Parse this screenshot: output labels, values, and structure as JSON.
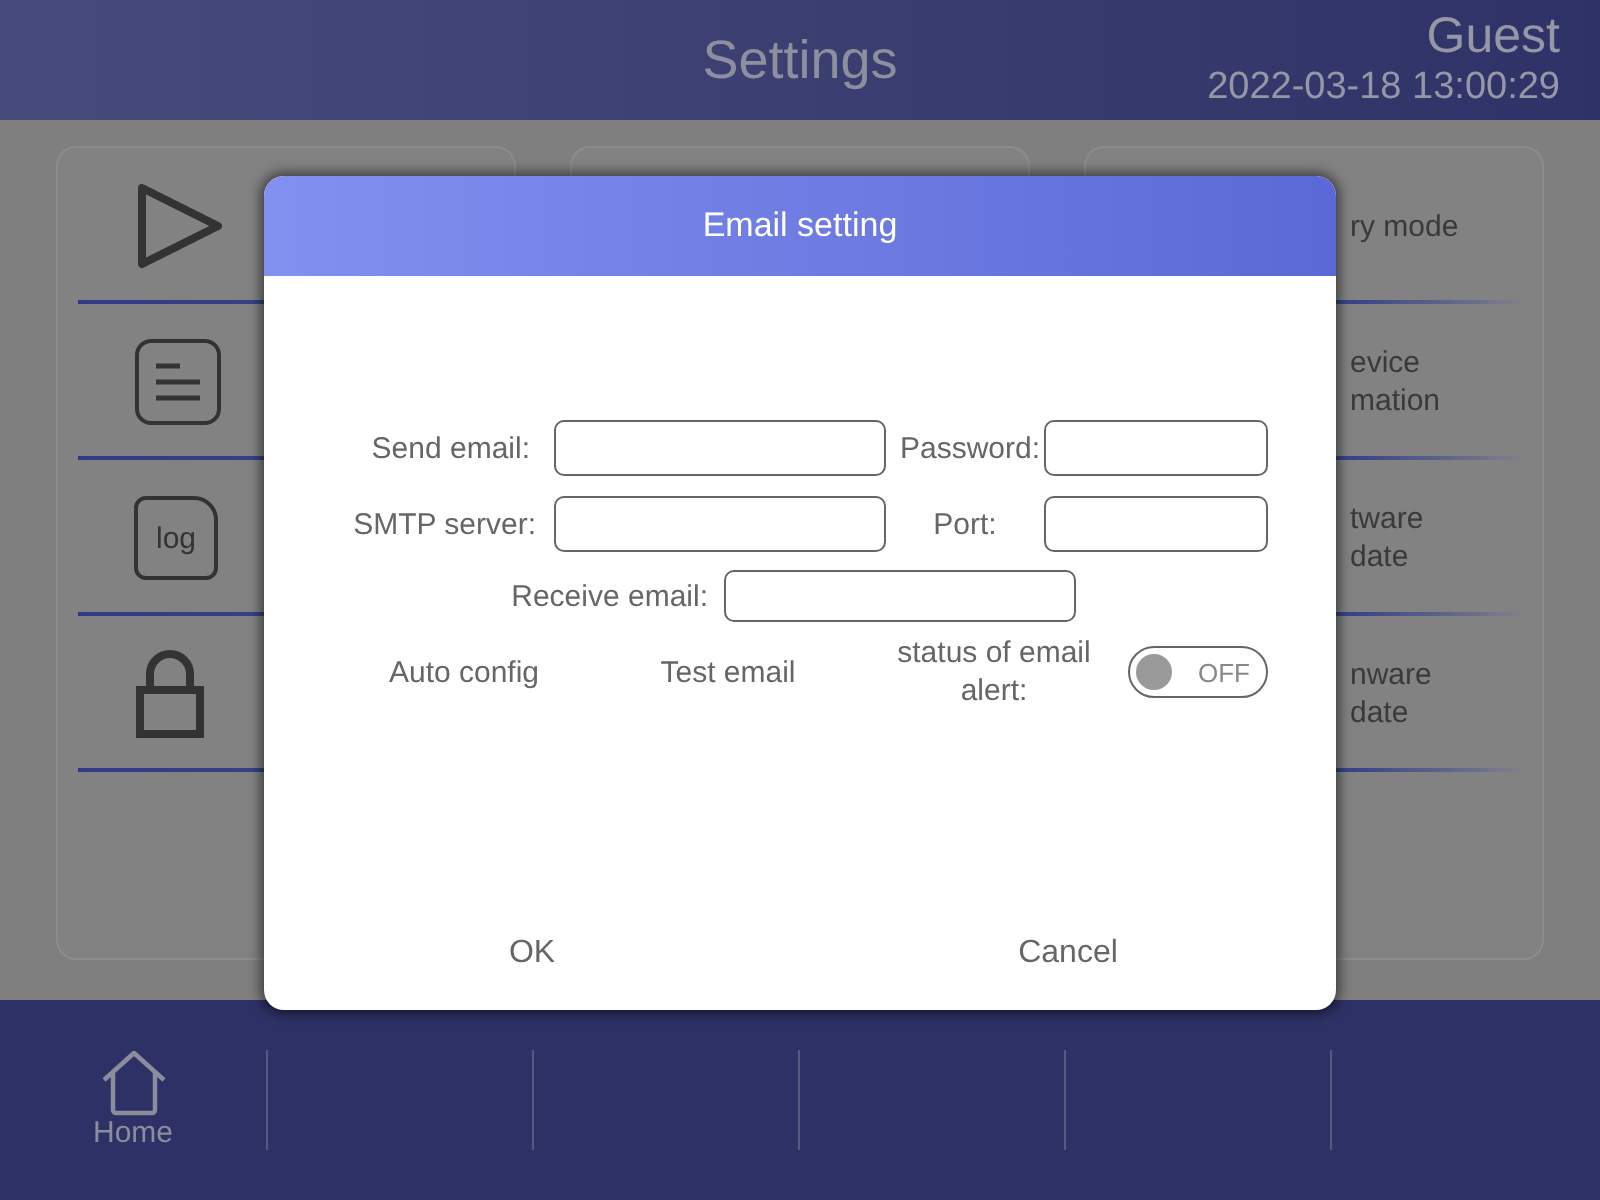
{
  "header": {
    "title": "Settings",
    "user": "Guest",
    "datetime": "2022-03-18 13:00:29"
  },
  "left_card": {
    "items": [
      {
        "kind": "play"
      },
      {
        "kind": "list"
      },
      {
        "kind": "log",
        "icon_text": "log"
      },
      {
        "kind": "lock"
      }
    ]
  },
  "right_card": {
    "items": [
      {
        "lines": [
          "ry mode"
        ]
      },
      {
        "lines": [
          "evice",
          "mation"
        ]
      },
      {
        "lines": [
          "tware",
          "date"
        ]
      },
      {
        "lines": [
          "nware",
          "date"
        ]
      }
    ]
  },
  "dialog": {
    "title": "Email setting",
    "send_email": {
      "label": "Send email:"
    },
    "password": {
      "label": "Password:"
    },
    "smtp_server": {
      "label": "SMTP server:"
    },
    "port": {
      "label": "Port:"
    },
    "receive_email": {
      "label": "Receive email:"
    },
    "auto_config": "Auto config",
    "test_email": "Test email",
    "alert_status": {
      "label": "status of email alert:",
      "toggle_text": "OFF",
      "on": false
    },
    "buttons": [
      "OK",
      "Cancel"
    ]
  },
  "bottom_bar": {
    "items": [
      {
        "kind": "home",
        "label": "Home"
      },
      {
        "kind": "empty"
      },
      {
        "kind": "empty"
      },
      {
        "kind": "empty"
      },
      {
        "kind": "empty"
      },
      {
        "kind": "empty"
      }
    ]
  }
}
